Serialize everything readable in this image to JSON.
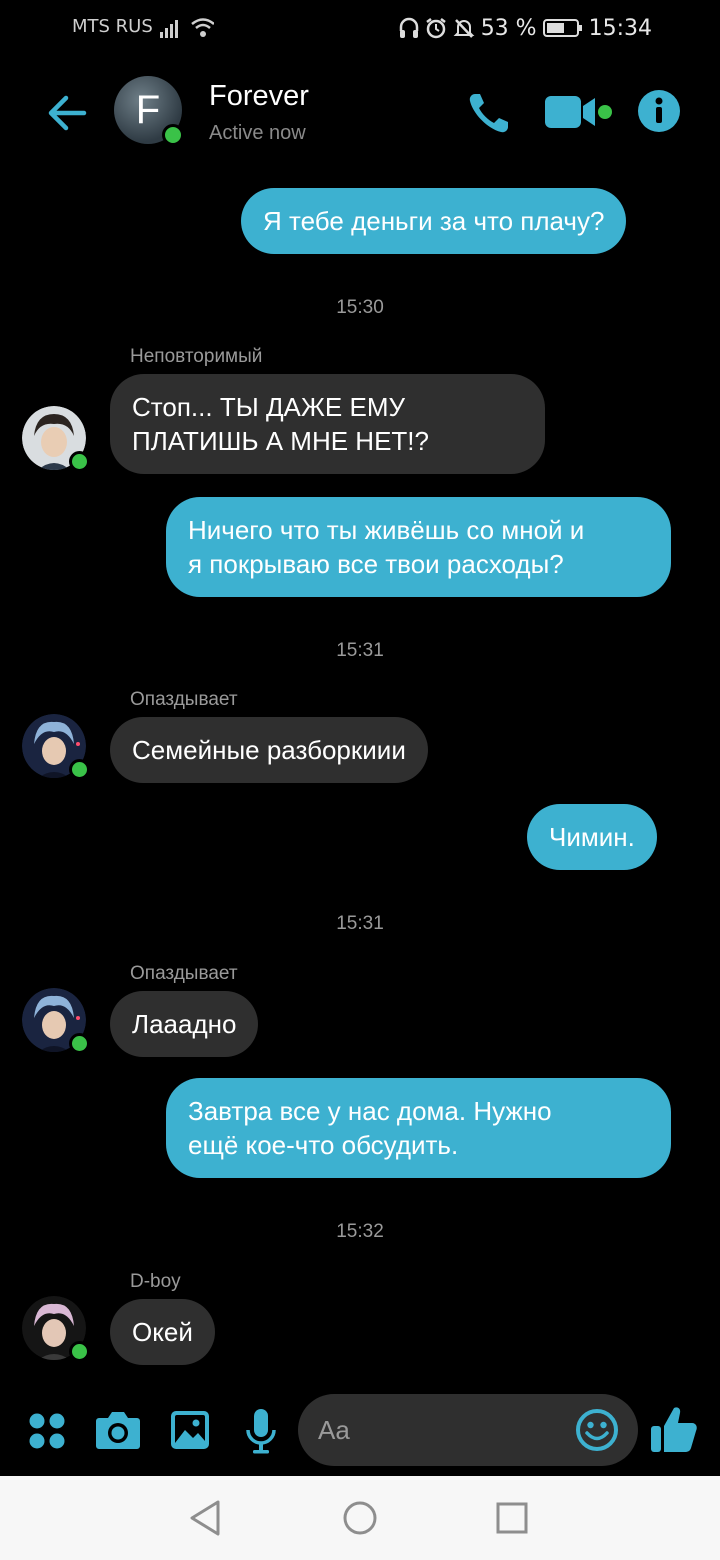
{
  "status_bar": {
    "carrier": "MTS RUS",
    "battery": "53 %",
    "time": "15:34"
  },
  "header": {
    "avatar_letter": "F",
    "title": "Forever",
    "subtitle": "Active now"
  },
  "messages": {
    "m1": {
      "text": "Я тебе деньги за что плачу?"
    },
    "t1": "15:30",
    "s2": "Неповторимый",
    "m2": {
      "line1": "Стоп... ТЫ ДАЖЕ ЕМУ",
      "line2": "ПЛАТИШЬ А МНЕ НЕТ!?"
    },
    "m3": {
      "line1": "Ничего что ты живёшь со мной и",
      "line2": "я покрываю все твои расходы?"
    },
    "t2": "15:31",
    "s4": "Опаздывает",
    "m4": {
      "text": "Семейные разборкиии"
    },
    "m5": {
      "text": "Чимин."
    },
    "t3": "15:31",
    "s6": "Опаздывает",
    "m6": {
      "text": "Лааадно"
    },
    "m7": {
      "line1": "Завтра все у нас дома. Нужно",
      "line2": "ещё кое-что обсудить."
    },
    "t4": "15:32",
    "s8": "D-boy",
    "m8": {
      "text": "Окей"
    }
  },
  "composer": {
    "placeholder": "Aa"
  },
  "colors": {
    "accent": "#3db1d0",
    "incoming_bubble": "#2f2f2f",
    "online": "#3ac248",
    "background": "#000000"
  },
  "icons": [
    "back-arrow-icon",
    "phone-icon",
    "video-call-icon",
    "info-icon",
    "apps-icon",
    "camera-icon",
    "gallery-icon",
    "microphone-icon",
    "emoji-icon",
    "thumbs-up-icon",
    "nav-back-icon",
    "nav-home-icon",
    "nav-recents-icon"
  ]
}
